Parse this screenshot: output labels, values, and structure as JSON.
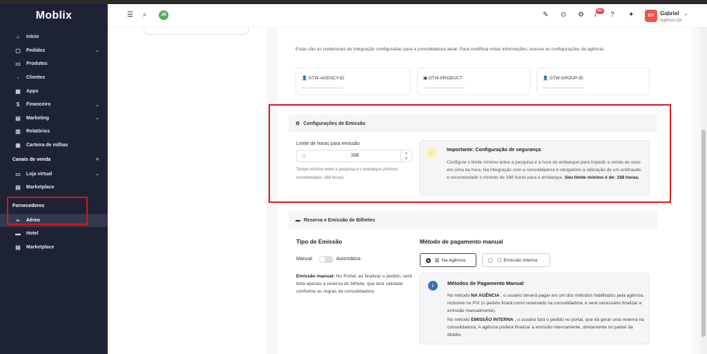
{
  "brand": "Moblix",
  "sidebar": {
    "items": [
      {
        "label": "Início",
        "icon": "home-icon",
        "glyph": "⌂"
      },
      {
        "label": "Pedidos",
        "icon": "document-icon",
        "glyph": "▢",
        "chev": "⌄"
      },
      {
        "label": "Produtos",
        "icon": "box-icon",
        "glyph": "▭"
      },
      {
        "label": "Clientes",
        "icon": "person-icon",
        "glyph": "◦"
      },
      {
        "label": "Apps",
        "icon": "grid-icon",
        "glyph": "▦"
      },
      {
        "label": "Financeiro",
        "icon": "coin-icon",
        "glyph": "$",
        "chev": "⌄"
      },
      {
        "label": "Marketing",
        "icon": "megaphone-icon",
        "glyph": "▤",
        "chev": "⌄"
      },
      {
        "label": "Relatórios",
        "icon": "chart-icon",
        "glyph": "▥"
      },
      {
        "label": "Carteira de milhas",
        "icon": "wallet-icon",
        "glyph": "▣"
      }
    ],
    "section_sales": "Canais de venda",
    "sales_items": [
      {
        "label": "Loja virtual",
        "icon": "monitor-icon",
        "glyph": "▭",
        "chev": "⌄"
      },
      {
        "label": "Marketplace",
        "icon": "store-icon",
        "glyph": "▤"
      }
    ],
    "section_suppliers": "Fornecedores",
    "supplier_items": [
      {
        "label": "Aéreo",
        "icon": "plane-icon",
        "glyph": "➢"
      },
      {
        "label": "Hotel",
        "icon": "bed-icon",
        "glyph": "▬"
      },
      {
        "label": "Marketplace",
        "icon": "store-icon",
        "glyph": "▤"
      }
    ]
  },
  "topbar": {
    "avatar": "JR",
    "badge": "99+",
    "user_name": "Gabriel",
    "user_agency": "Agência QA",
    "user_initials": "GV"
  },
  "credentials": {
    "intro": "Estas são as credenciais de integração configuradas para a consolidadora atual. Para modificar estas informações, acesse as configurações da agência.",
    "cards": [
      "GTW-AGENCY-ID",
      "GTW-PRODUCT",
      "GTW-GROUP-ID"
    ]
  },
  "emission": {
    "title": "Configurações de Emissão",
    "hours_label": "Limite de horas para emissão",
    "hours_value": "168",
    "hours_help": "Tempo mínimo entre a pesquisa e o embarque (mínimo recomendado: 168 horas)",
    "important_title": "Importante: Configuração de segurança",
    "important_text": "Configure o limite mínimo entre a pesquisa e a hora do embarque para impedir a venda de voos em cima da hora. Na integração com a consolidadora é obrigatório a utilização de um antifraude, e recomendado o mínimo de 168 horas para o embarque.",
    "important_bold": "Seu limite mínimo é de: 168 horas."
  },
  "booking": {
    "title": "Reserva e Emissão de Bilhetes",
    "type_title": "Tipo de Emissão",
    "manual": "Manual",
    "automatic": "Automática",
    "manual_desc_bold": "Emissão manual:",
    "manual_desc": "No Portal, ao finalizar o pedido, será feita apenas a reserva do bilhete, que terá validade conforme as regras da consolidadora.",
    "payment_title": "Método de pagamento manual",
    "opt_agency": "Na Agência",
    "opt_internal": "Emissão interna",
    "pm_title": "Métodos de Pagamento Manual",
    "pm_p1_prefix": "No método",
    "pm_p1_bold": "NA AGÊNCIA",
    "pm_p1": ", o usuário deverá pagar em um dos métodos habilitados pela agência, inclusive no PIX (o pedido ficará como reservado na consolidadora, e será necessário finalizar a emissão manualmente).",
    "pm_p2_prefix": "No método",
    "pm_p2_bold": "EMISSÃO INTERNA",
    "pm_p2": ", o usuário fará o pedido no portal, que irá gerar uma reserva na consolidadora. A agência poderá finalizar a emissão internamente, diretamente no painel da Moblix."
  }
}
